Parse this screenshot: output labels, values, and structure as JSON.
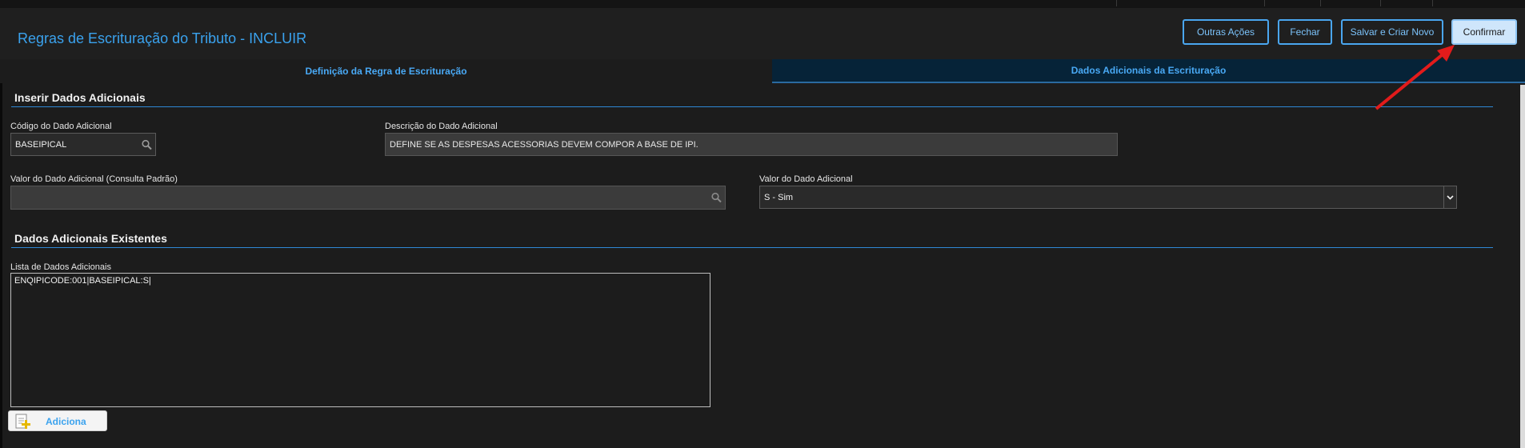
{
  "header": {
    "title": "Regras de Escrituração do Tributo - INCLUIR",
    "buttons": {
      "outras_acoes": "Outras Ações",
      "fechar": "Fechar",
      "salvar_criar_novo": "Salvar e Criar Novo",
      "confirmar": "Confirmar"
    }
  },
  "tabs": [
    {
      "label": "Definição da Regra de Escrituração",
      "active": false
    },
    {
      "label": "Dados Adicionais da Escrituração",
      "active": true
    }
  ],
  "inserir": {
    "section_title": "Inserir Dados Adicionais",
    "codigo_label": "Código do Dado Adicional",
    "codigo_value": "BASEIPICAL",
    "descricao_label": "Descrição do Dado Adicional",
    "descricao_value": "DEFINE SE AS DESPESAS ACESSORIAS DEVEM COMPOR A BASE DE IPI.",
    "valor_consulta_label": "Valor do Dado Adicional (Consulta Padrão)",
    "valor_consulta_value": "",
    "valor_label": "Valor do Dado Adicional",
    "valor_value": "S - Sim"
  },
  "existentes": {
    "section_title": "Dados Adicionais Existentes",
    "lista_label": "Lista de Dados Adicionais",
    "lista_value": "ENQIPICODE:001|BASEIPICAL:S|",
    "adiciona_label": "Adiciona"
  },
  "colors": {
    "accent": "#3aa2ee",
    "background": "#1c1c1c",
    "annotation_arrow": "#e21b1b"
  },
  "icons": [
    "search-icon",
    "chevron-down-icon",
    "add-document-icon",
    "annotation-arrow"
  ]
}
